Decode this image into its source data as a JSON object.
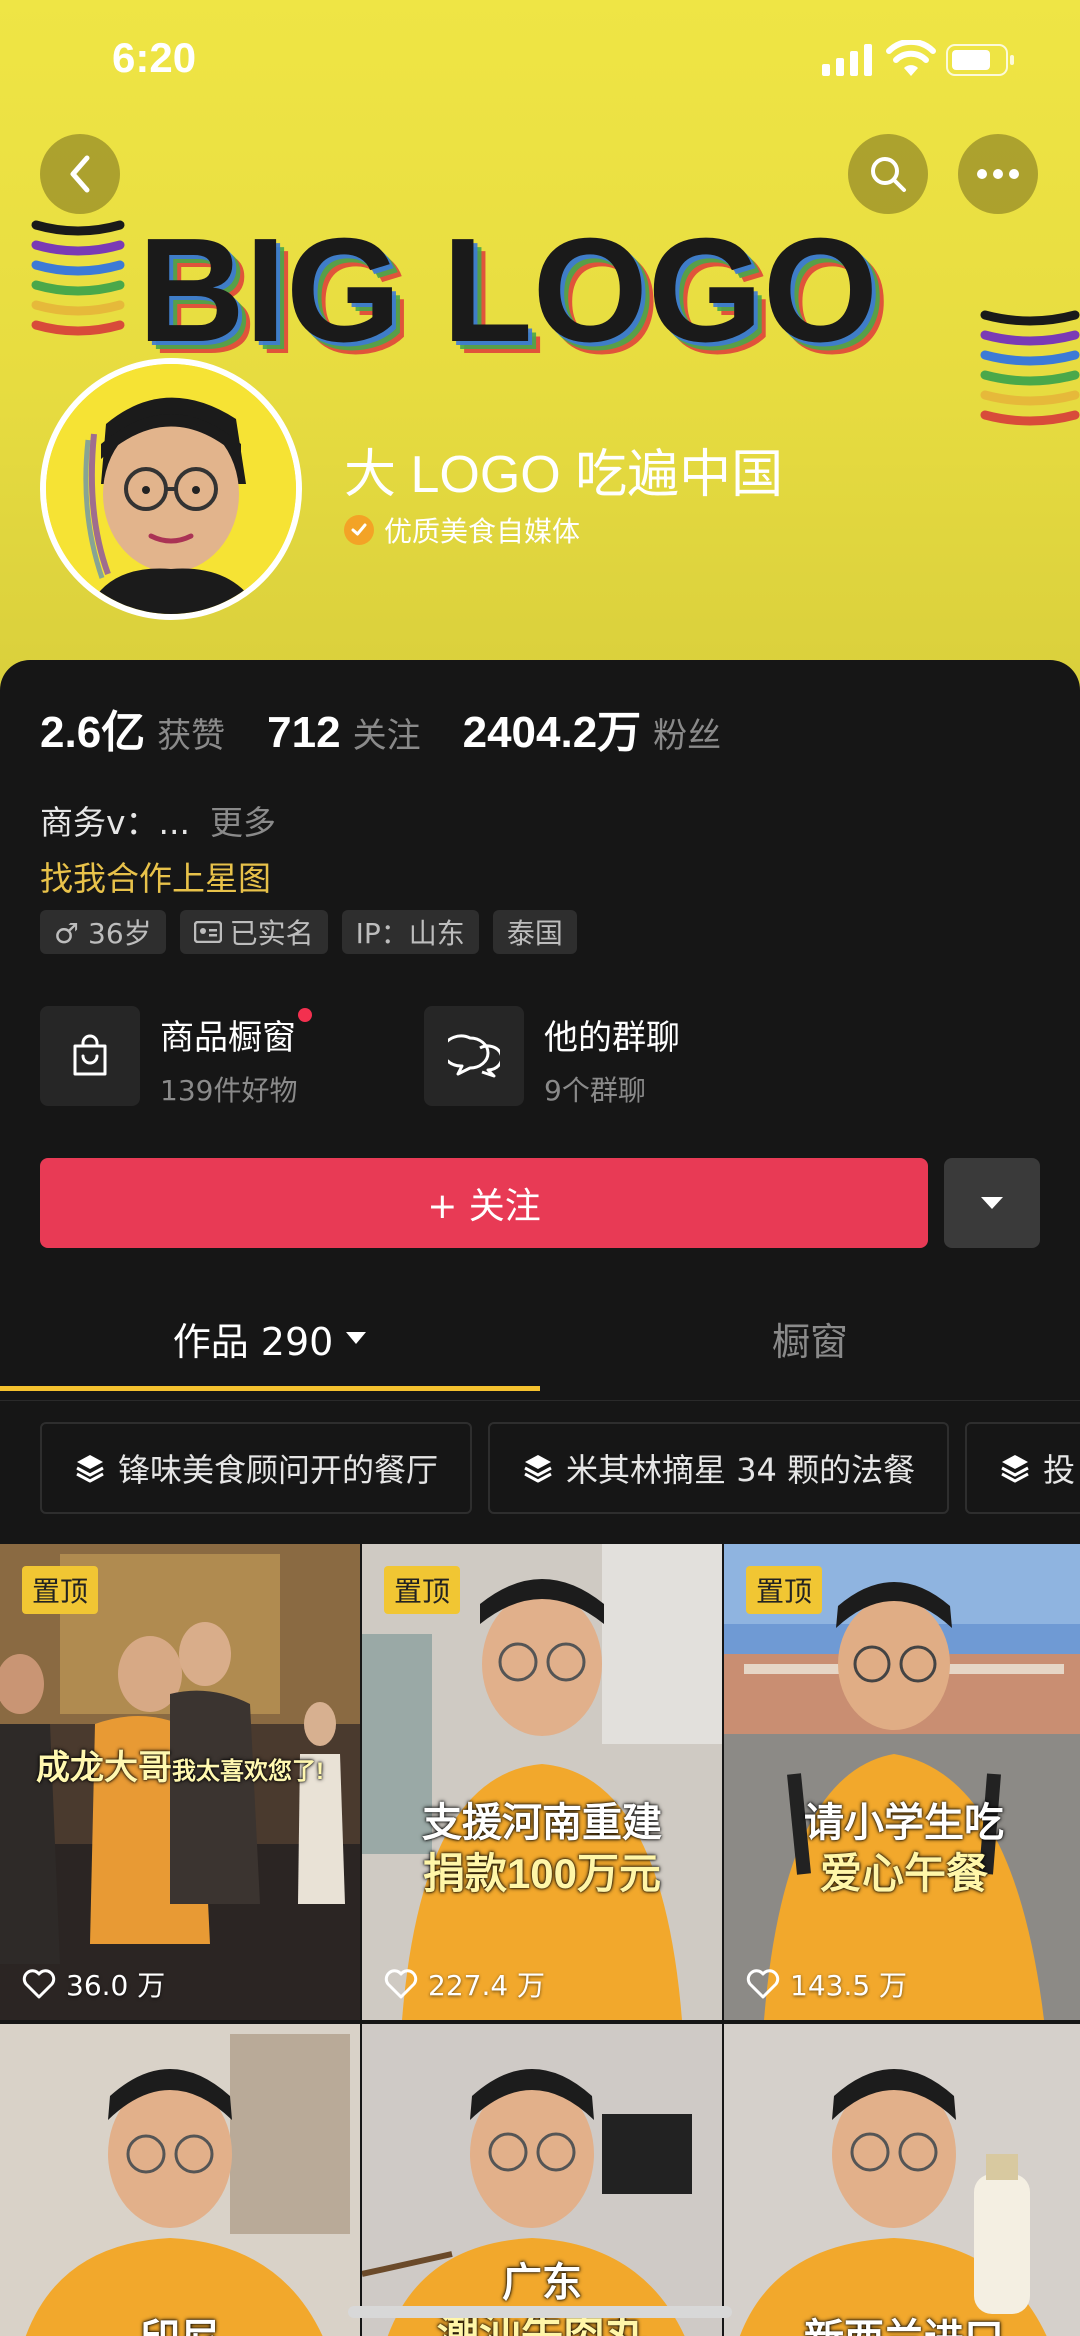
{
  "status_bar": {
    "time": "6:20"
  },
  "profile": {
    "logo_text": "BIG LOGO",
    "name": "大 LOGO 吃遍中国",
    "verified": "优质美食自媒体"
  },
  "stats": [
    {
      "value": "2.6亿",
      "label": "获赞"
    },
    {
      "value": "712",
      "label": "关注"
    },
    {
      "value": "2404.2万",
      "label": "粉丝"
    }
  ],
  "bio": {
    "line1": "商务v：...",
    "more": "更多",
    "line2": "找我合作上星图"
  },
  "tags": [
    "♂ 36岁",
    "已实名",
    "IP：山东",
    "泰国"
  ],
  "shops": [
    {
      "title": "商品橱窗",
      "subtitle": "139件好物"
    },
    {
      "title": "他的群聊",
      "subtitle": "9个群聊"
    }
  ],
  "follow_label": "+ 关注",
  "tabs": {
    "works": "作品 290",
    "shop": "橱窗"
  },
  "collections": [
    "锋味美食顾问开的餐厅",
    "米其林摘星 34 颗的法餐",
    "投"
  ],
  "videos": [
    {
      "pinned": "置顶",
      "caption_big": "成龙大哥",
      "caption_small": "我太喜欢您了!",
      "likes": "36.0 万"
    },
    {
      "pinned": "置顶",
      "caption1": "支援河南重建",
      "caption2": "捐款100万元",
      "likes": "227.4 万"
    },
    {
      "pinned": "置顶",
      "caption1": "请小学生吃",
      "caption2": "爱心午餐",
      "likes": "143.5 万"
    },
    {
      "caption1": "印尼"
    },
    {
      "caption1": "广东",
      "caption2": "潮汕牛肉丸"
    },
    {
      "caption1": "新西兰进口"
    }
  ],
  "colors": {
    "accent": "#e83a55",
    "header_yellow": "#efe545",
    "highlight": "#e8c24a",
    "tab_underline": "#f5c12e"
  }
}
